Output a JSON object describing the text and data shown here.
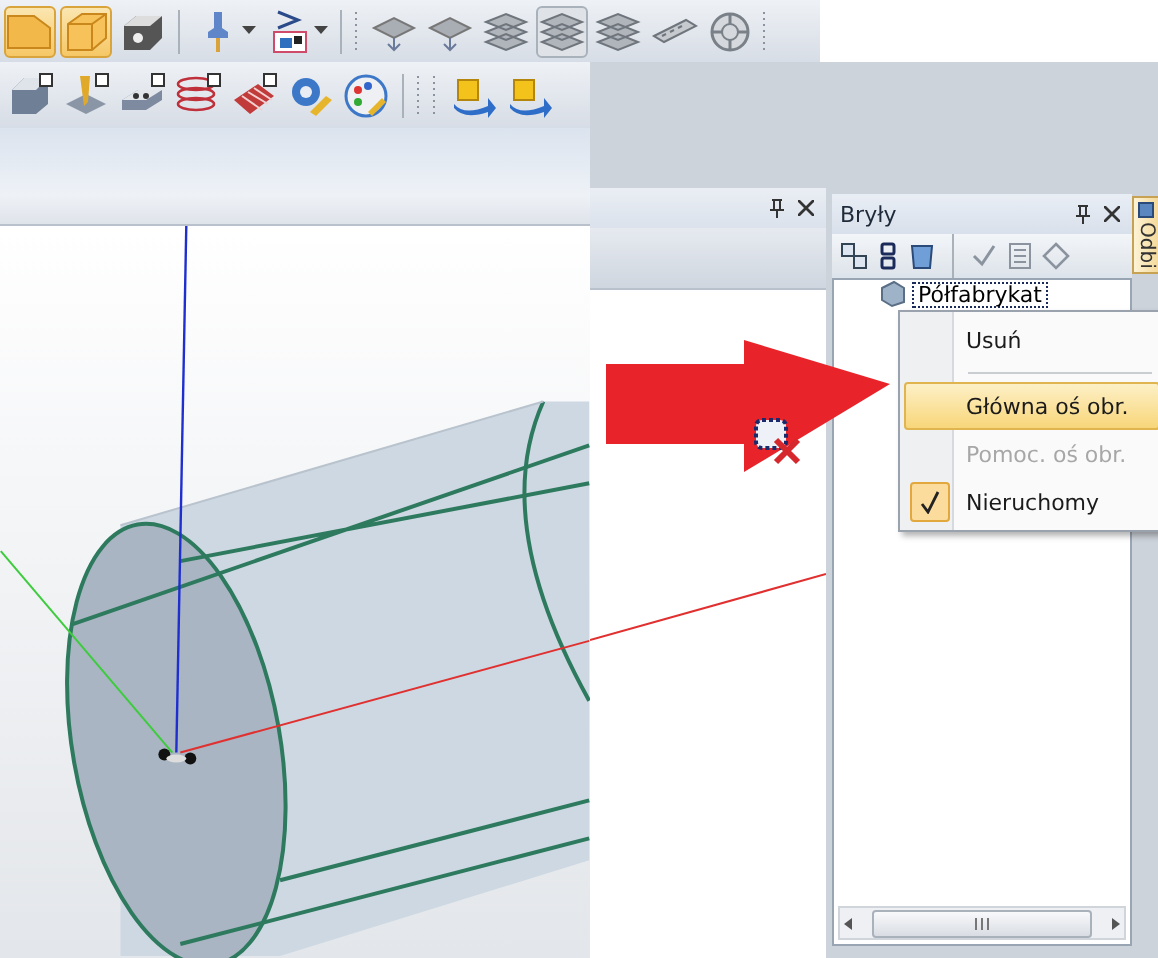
{
  "toolbars": [
    {
      "buttons": [
        {
          "kind": "partial",
          "pressed": true
        },
        {
          "kind": "box",
          "pressed": true
        },
        {
          "kind": "box-hole",
          "pressed": false
        },
        {
          "kind": "sep"
        },
        {
          "kind": "tool",
          "pressed": false,
          "dropdown": true
        },
        {
          "kind": "style",
          "pressed": false,
          "dropdown": true
        },
        {
          "kind": "sep"
        },
        {
          "kind": "grip"
        },
        {
          "kind": "surface",
          "pressed": false
        },
        {
          "kind": "surface",
          "pressed": false
        },
        {
          "kind": "layers",
          "pressed": false
        },
        {
          "kind": "layers",
          "pressed": true
        },
        {
          "kind": "layers",
          "pressed": false
        },
        {
          "kind": "strip",
          "pressed": false
        },
        {
          "kind": "wheel",
          "pressed": false
        },
        {
          "kind": "grip"
        }
      ]
    },
    {
      "buttons": [
        {
          "kind": "block",
          "pressed": false
        },
        {
          "kind": "drill",
          "pressed": false
        },
        {
          "kind": "holes",
          "pressed": false
        },
        {
          "kind": "spring",
          "pressed": false
        },
        {
          "kind": "ribbed",
          "pressed": false
        },
        {
          "kind": "gear",
          "pressed": false
        },
        {
          "kind": "palette",
          "pressed": false
        },
        {
          "kind": "sep"
        },
        {
          "kind": "grip"
        },
        {
          "kind": "grip"
        },
        {
          "kind": "arrow3d",
          "pressed": false
        },
        {
          "kind": "arrow3d",
          "pressed": false
        }
      ]
    }
  ],
  "solids_panel": {
    "title": "Bryły",
    "tree": [
      {
        "label": "Półfabrykat",
        "selected": true
      }
    ]
  },
  "side_tabs": [
    {
      "label": "Odbi"
    }
  ],
  "context_menu": {
    "items": [
      {
        "kind": "item",
        "label": "Usuń",
        "selected": false,
        "disabled": false,
        "checked": false
      },
      {
        "kind": "separator"
      },
      {
        "kind": "item",
        "label": "Główna oś obr.",
        "selected": true,
        "disabled": false,
        "checked": false
      },
      {
        "kind": "item",
        "label": "Pomoc. oś obr.",
        "selected": false,
        "disabled": true,
        "checked": false
      },
      {
        "kind": "item",
        "label": "Nieruchomy",
        "selected": false,
        "disabled": false,
        "checked": true
      }
    ]
  }
}
